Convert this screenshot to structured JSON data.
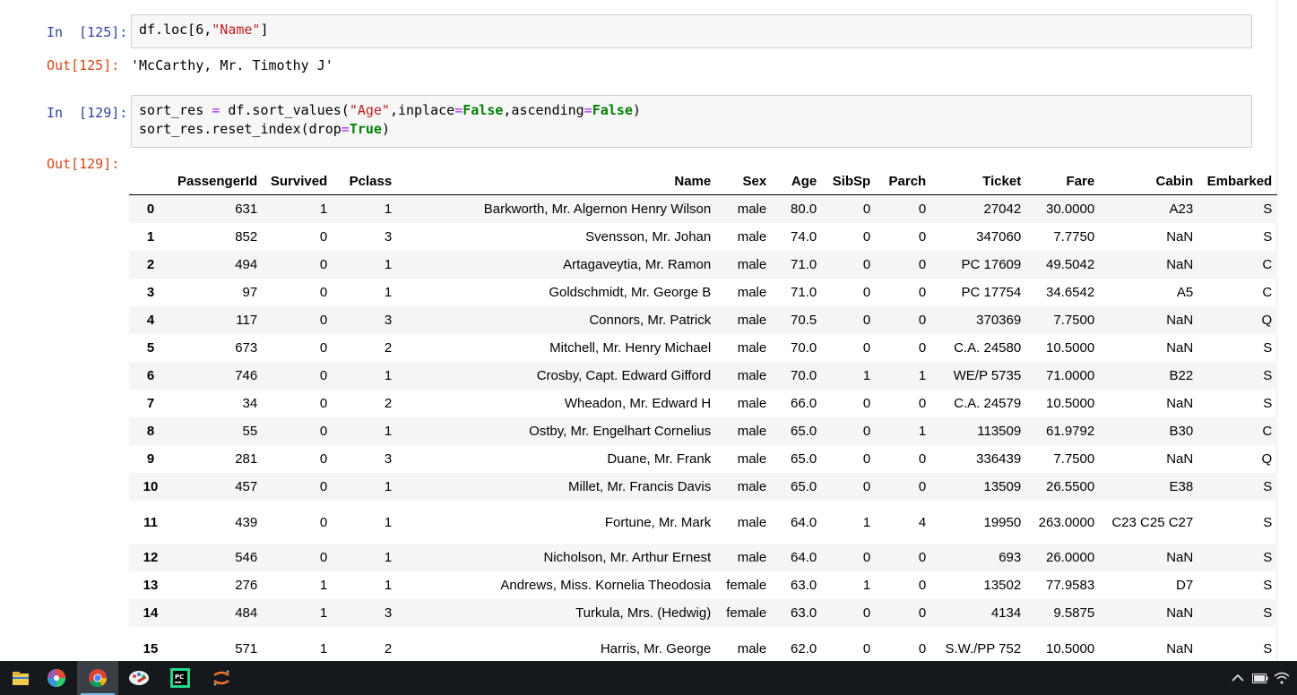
{
  "cells": [
    {
      "in_prompt": "In  [125]:",
      "code_lines": [
        [
          {
            "t": "df.loc[6,"
          },
          {
            "t": "\"Name\"",
            "c": "str"
          },
          {
            "t": "]"
          }
        ]
      ],
      "out_prompt": "Out[125]:",
      "output_text": "'McCarthy, Mr. Timothy J'"
    },
    {
      "in_prompt": "In  [129]:",
      "code_lines": [
        [
          {
            "t": "sort_res "
          },
          {
            "t": "=",
            "c": "op"
          },
          {
            "t": " df.sort_values("
          },
          {
            "t": "\"Age\"",
            "c": "str"
          },
          {
            "t": ",inplace"
          },
          {
            "t": "=",
            "c": "op"
          },
          {
            "t": "False",
            "c": "kw"
          },
          {
            "t": ",ascending"
          },
          {
            "t": "=",
            "c": "op"
          },
          {
            "t": "False",
            "c": "kw"
          },
          {
            "t": ")"
          }
        ],
        [
          {
            "t": "sort_res.reset_index(drop"
          },
          {
            "t": "=",
            "c": "op"
          },
          {
            "t": "True",
            "c": "kw"
          },
          {
            "t": ")"
          }
        ]
      ],
      "out_prompt": "Out[129]:"
    }
  ],
  "dataframe": {
    "columns": [
      "PassengerId",
      "Survived",
      "Pclass",
      "Name",
      "Sex",
      "Age",
      "SibSp",
      "Parch",
      "Ticket",
      "Fare",
      "Cabin",
      "Embarked"
    ],
    "rows": [
      {
        "index": "0",
        "cells": [
          "631",
          "1",
          "1",
          "Barkworth, Mr. Algernon Henry Wilson",
          "male",
          "80.0",
          "0",
          "0",
          "27042",
          "30.0000",
          "A23",
          "S"
        ]
      },
      {
        "index": "1",
        "cells": [
          "852",
          "0",
          "3",
          "Svensson, Mr. Johan",
          "male",
          "74.0",
          "0",
          "0",
          "347060",
          "7.7750",
          "NaN",
          "S"
        ]
      },
      {
        "index": "2",
        "cells": [
          "494",
          "0",
          "1",
          "Artagaveytia, Mr. Ramon",
          "male",
          "71.0",
          "0",
          "0",
          "PC 17609",
          "49.5042",
          "NaN",
          "C"
        ]
      },
      {
        "index": "3",
        "cells": [
          "97",
          "0",
          "1",
          "Goldschmidt, Mr. George B",
          "male",
          "71.0",
          "0",
          "0",
          "PC 17754",
          "34.6542",
          "A5",
          "C"
        ]
      },
      {
        "index": "4",
        "cells": [
          "117",
          "0",
          "3",
          "Connors, Mr. Patrick",
          "male",
          "70.5",
          "0",
          "0",
          "370369",
          "7.7500",
          "NaN",
          "Q"
        ]
      },
      {
        "index": "5",
        "cells": [
          "673",
          "0",
          "2",
          "Mitchell, Mr. Henry Michael",
          "male",
          "70.0",
          "0",
          "0",
          "C.A. 24580",
          "10.5000",
          "NaN",
          "S"
        ]
      },
      {
        "index": "6",
        "cells": [
          "746",
          "0",
          "1",
          "Crosby, Capt. Edward Gifford",
          "male",
          "70.0",
          "1",
          "1",
          "WE/P 5735",
          "71.0000",
          "B22",
          "S"
        ]
      },
      {
        "index": "7",
        "cells": [
          "34",
          "0",
          "2",
          "Wheadon, Mr. Edward H",
          "male",
          "66.0",
          "0",
          "0",
          "C.A. 24579",
          "10.5000",
          "NaN",
          "S"
        ]
      },
      {
        "index": "8",
        "cells": [
          "55",
          "0",
          "1",
          "Ostby, Mr. Engelhart Cornelius",
          "male",
          "65.0",
          "0",
          "1",
          "113509",
          "61.9792",
          "B30",
          "C"
        ]
      },
      {
        "index": "9",
        "cells": [
          "281",
          "0",
          "3",
          "Duane, Mr. Frank",
          "male",
          "65.0",
          "0",
          "0",
          "336439",
          "7.7500",
          "NaN",
          "Q"
        ]
      },
      {
        "index": "10",
        "cells": [
          "457",
          "0",
          "1",
          "Millet, Mr. Francis Davis",
          "male",
          "65.0",
          "0",
          "0",
          "13509",
          "26.5500",
          "E38",
          "S"
        ]
      },
      {
        "index": "11",
        "cells": [
          "439",
          "0",
          "1",
          "Fortune, Mr. Mark",
          "male",
          "64.0",
          "1",
          "4",
          "19950",
          "263.0000",
          "C23 C25 C27",
          "S"
        ]
      },
      {
        "index": "12",
        "cells": [
          "546",
          "0",
          "1",
          "Nicholson, Mr. Arthur Ernest",
          "male",
          "64.0",
          "0",
          "0",
          "693",
          "26.0000",
          "NaN",
          "S"
        ]
      },
      {
        "index": "13",
        "cells": [
          "276",
          "1",
          "1",
          "Andrews, Miss. Kornelia Theodosia",
          "female",
          "63.0",
          "1",
          "0",
          "13502",
          "77.9583",
          "D7",
          "S"
        ]
      },
      {
        "index": "14",
        "cells": [
          "484",
          "1",
          "3",
          "Turkula, Mrs. (Hedwig)",
          "female",
          "63.0",
          "0",
          "0",
          "4134",
          "9.5875",
          "NaN",
          "S"
        ]
      },
      {
        "index": "15",
        "cells": [
          "571",
          "1",
          "2",
          "Harris, Mr. George",
          "male",
          "62.0",
          "0",
          "0",
          "S.W./PP 752",
          "10.5000",
          "NaN",
          "S"
        ]
      }
    ]
  },
  "taskbar": {
    "apps": [
      {
        "name": "file-explorer-icon",
        "color": "#f2c94c"
      },
      {
        "name": "color-wheel-app-icon",
        "color": "#e94e77"
      },
      {
        "name": "chrome-icon",
        "color": "#4285f4"
      },
      {
        "name": "paint-app-icon",
        "color": "#e04a3f"
      },
      {
        "name": "pycharm-icon",
        "color": "#21d789"
      },
      {
        "name": "jupyter-icon",
        "color": "#f37626"
      }
    ],
    "active_app": "chrome-icon"
  }
}
